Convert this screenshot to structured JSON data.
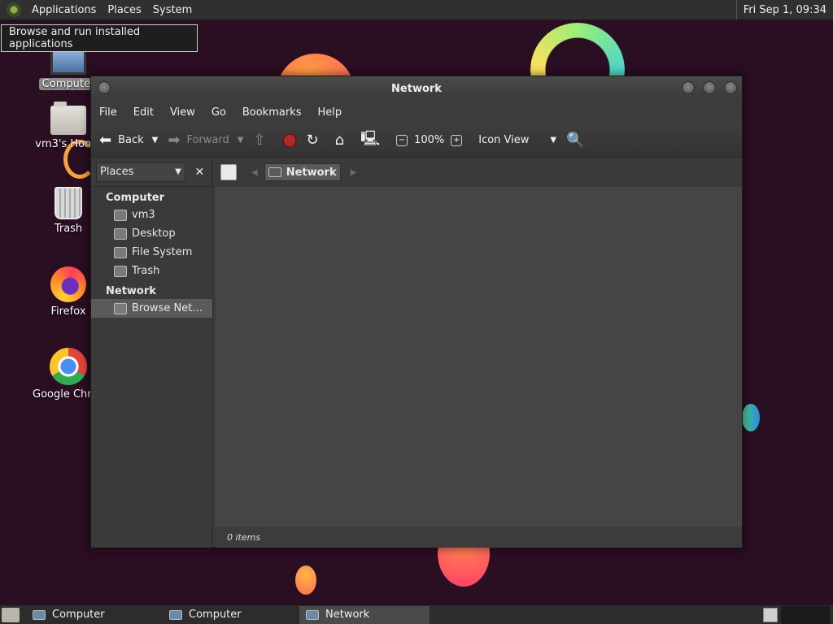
{
  "top_panel": {
    "menus": [
      "Applications",
      "Places",
      "System"
    ],
    "clock": "Fri Sep  1, 09:34"
  },
  "tooltip": "Browse and run installed applications",
  "desktop_icons": [
    {
      "label": "Computer",
      "icon": "monitor-icon"
    },
    {
      "label": "vm3's Home",
      "icon": "home-folder-icon"
    },
    {
      "label": "Trash",
      "icon": "trash-icon"
    },
    {
      "label": "Firefox",
      "icon": "firefox-icon"
    },
    {
      "label": "Google Chrome",
      "icon": "chrome-icon"
    }
  ],
  "window": {
    "title": "Network",
    "menu": [
      "File",
      "Edit",
      "View",
      "Go",
      "Bookmarks",
      "Help"
    ],
    "toolbar": {
      "back": "Back",
      "forward": "Forward",
      "zoom": "100%",
      "view_mode": "Icon View"
    },
    "sidebar": {
      "selector": "Places",
      "groups": [
        {
          "label": "Computer",
          "items": [
            "vm3",
            "Desktop",
            "File System",
            "Trash"
          ]
        },
        {
          "label": "Network",
          "items": [
            "Browse Net…"
          ]
        }
      ]
    },
    "location": "Network",
    "status": "0 items"
  },
  "taskbar": {
    "tasks": [
      "Computer",
      "Computer",
      "Network"
    ],
    "active_task": 2
  },
  "colors": {
    "desktop_bg": "#2a0e22",
    "panel_bg": "#303030",
    "window_bg": "#3c3c3c",
    "content_bg": "#454545"
  }
}
